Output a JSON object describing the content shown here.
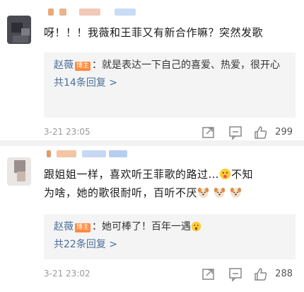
{
  "comments": [
    {
      "text": "呀！！！我薇和王菲又有新合作嘛？突然发歌",
      "reply": {
        "author": "赵薇",
        "badge": "博主",
        "text": "：就是表达一下自己的喜爱、热爱，很开心"
      },
      "reply_count": "共14条回复 >",
      "timestamp": "3-21 23:05",
      "likes": "299"
    },
    {
      "text_line1": "跟姐姐一样，喜欢听王菲歌的路过…",
      "text_line1_after": "不知",
      "text_line2": "为啥，她的歌很耐听，百听不厌",
      "reply": {
        "author": "赵薇",
        "badge": "博主",
        "text": "：她可棒了！百年一遇"
      },
      "reply_count": "共22条回复 >",
      "timestamp": "3-21 23:02",
      "likes": "288"
    }
  ],
  "icons": {
    "share": "share-icon",
    "comment": "comment-icon",
    "like": "thumbs-up-icon",
    "emoji_tongue": "tongue-emoji-icon",
    "emoji_dog": "dog-face-emoji-icon",
    "emoji_surprised": "surprised-face-emoji-icon"
  },
  "colors": {
    "link_blue": "#4a6e99",
    "badge_orange": "#ff8a3d",
    "reply_bg": "#f4f4f4"
  }
}
